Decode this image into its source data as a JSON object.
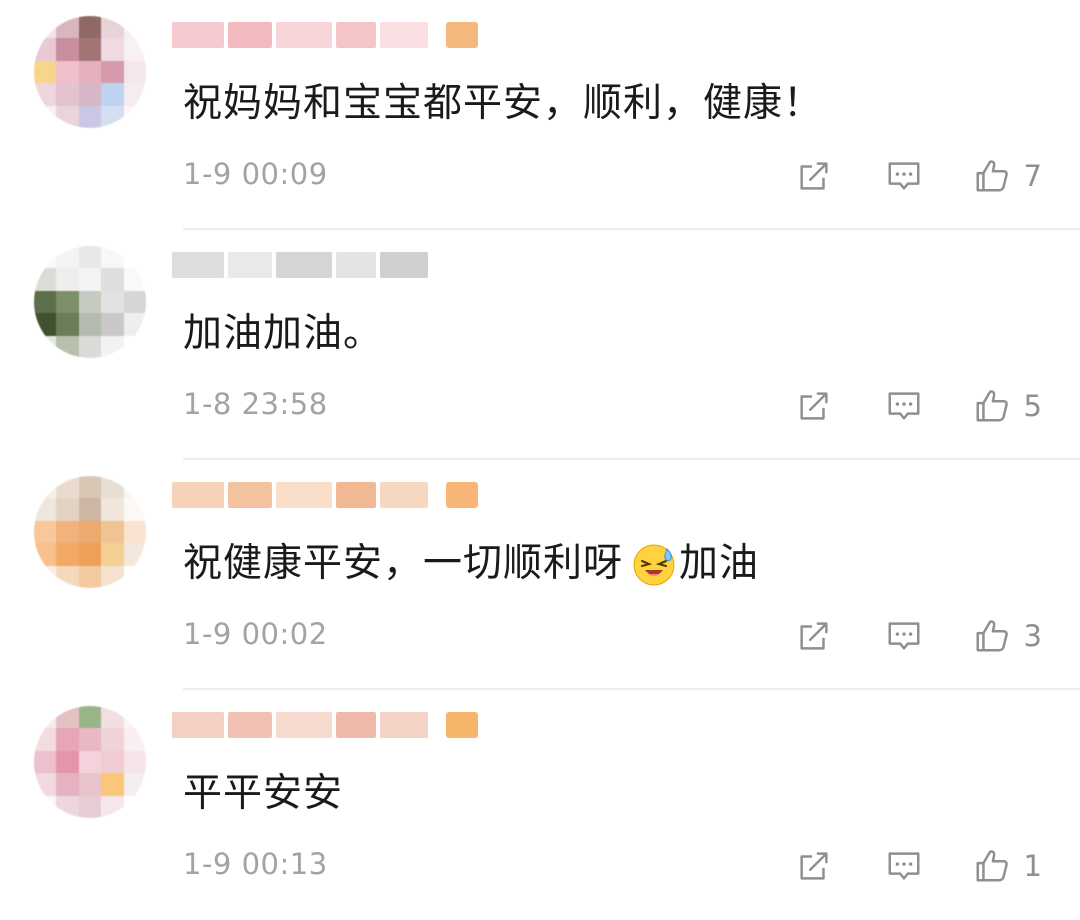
{
  "comments": [
    {
      "content": "祝妈妈和宝宝都平安，顺利，健康！",
      "time": "1-9 00:09",
      "likes": "7",
      "has_emoji": false,
      "avatar_colors": [
        "#f4e4ea",
        "#d9b6bd",
        "#8e6a63",
        "#e8d3d7",
        "#f7f0f3",
        "#e9c9d3",
        "#c78ea0",
        "#a47474",
        "#f0d9e2",
        "#f8f1f4",
        "#f7d58a",
        "#f2bfcc",
        "#e6b1bf",
        "#d59aab",
        "#f4e6ec",
        "#efd5dc",
        "#e4c2cf",
        "#d7b6c6",
        "#bfd3ef",
        "#f5ecf0",
        "#f8f0f3",
        "#ead4dc",
        "#c9c7e3",
        "#d4dff2",
        "#fbf7f9"
      ],
      "name_colors": [
        "#f6c9cf",
        "#f2b9be",
        "#f7d4d7",
        "#f4c4c8",
        "#f9dfe1"
      ],
      "badge_color": "#f5b97d"
    },
    {
      "content": "加油加油。",
      "time": "1-8 23:58",
      "likes": "5",
      "has_emoji": false,
      "avatar_colors": [
        "#fafafa",
        "#f4f4f4",
        "#e7e7e7",
        "#f7f7f7",
        "#ffffff",
        "#d9dcd7",
        "#eeeeee",
        "#f3f3f3",
        "#dedede",
        "#f9f9f9",
        "#5e6f4b",
        "#7b8f69",
        "#c5cbc1",
        "#e2e2e2",
        "#d6d6d6",
        "#41502f",
        "#6c7d5a",
        "#b4bbb0",
        "#c8c8c8",
        "#eeeeee",
        "#e6e8e3",
        "#b8c0ad",
        "#d9dcd6",
        "#f2f2f2",
        "#ffffff"
      ],
      "name_colors": [
        "#dddddd",
        "#e9e9e9",
        "#d5d5d5",
        "#e3e3e3",
        "#cfcfcf"
      ],
      "badge_color": "#ffffff"
    },
    {
      "content": "祝健康平安，一切顺利呀",
      "content_after": "加油",
      "time": "1-9 00:02",
      "likes": "3",
      "has_emoji": true,
      "emoji_name": "crying-laughing-emoji",
      "avatar_colors": [
        "#f5efe8",
        "#e9dccf",
        "#d9c6b5",
        "#e7ded5",
        "#f9f6f2",
        "#efe6dd",
        "#e3d3c4",
        "#cdb7a3",
        "#f0e6dc",
        "#fbf8f5",
        "#f6c89c",
        "#f2b27a",
        "#ecaa6e",
        "#f0c392",
        "#f7e3cf",
        "#f7c08c",
        "#f1a965",
        "#eea05a",
        "#f5cf93",
        "#f3e8db",
        "#f8efe4",
        "#f5d9bc",
        "#f3c9a0",
        "#f4e2cf",
        "#ffffff"
      ],
      "name_colors": [
        "#f6d3b8",
        "#f3c3a0",
        "#f9dfca",
        "#f0b993",
        "#f6d7c0"
      ],
      "badge_color": "#f7b675"
    },
    {
      "content": "平平安安",
      "time": "1-9 00:13",
      "likes": "1",
      "has_emoji": false,
      "avatar_colors": [
        "#f6ece8",
        "#e6c1c3",
        "#9ab58a",
        "#f1dfe1",
        "#faf4f5",
        "#f3dcdf",
        "#e7a6b8",
        "#e8b8c4",
        "#f0d3d9",
        "#f9eef0",
        "#ecc0cd",
        "#e495ab",
        "#f4d2dc",
        "#f0cbd3",
        "#f7e4e8",
        "#f2d9df",
        "#e6b1c0",
        "#e9c3cc",
        "#f8c77a",
        "#f5eef0",
        "#fbf6f7",
        "#eed6dc",
        "#e8ccd3",
        "#f4e7ea",
        "#ffffff"
      ],
      "name_colors": [
        "#f4cfc4",
        "#f1c1b3",
        "#f7dbd0",
        "#eeb9ab",
        "#f5d2c6"
      ],
      "badge_color": "#f5b56b"
    }
  ],
  "icons": {
    "share": "share-icon",
    "reply": "comment-icon",
    "like": "thumbs-up-icon"
  },
  "colors": {
    "text": "#1a1a1a",
    "meta": "#a3a3a3",
    "icon": "#8f8f8f",
    "divider": "#eeeeee"
  }
}
